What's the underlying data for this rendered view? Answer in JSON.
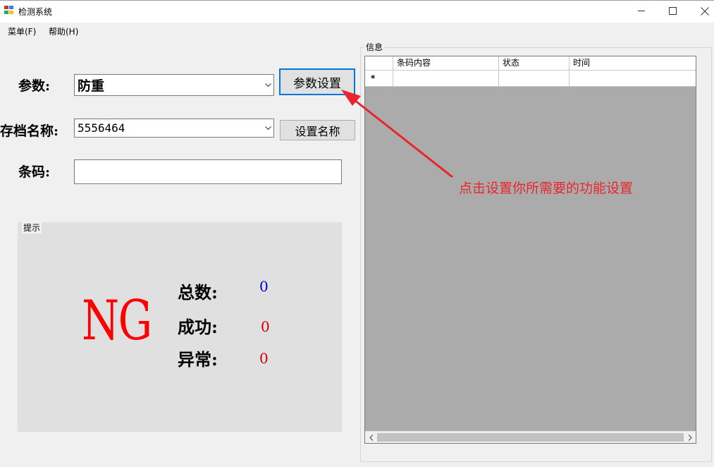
{
  "window": {
    "title": "检测系统",
    "minimize_icon": "minimize-icon",
    "maximize_icon": "maximize-icon",
    "close_icon": "close-icon"
  },
  "menu": {
    "items": [
      {
        "label": "菜单(F)"
      },
      {
        "label": "帮助(H)"
      }
    ]
  },
  "form": {
    "param_label": "参数:",
    "param_value": "防重",
    "param_button": "参数设置",
    "archive_label": "存档名称:",
    "archive_value": "5556464",
    "archive_button": "设置名称",
    "barcode_label": "条码:",
    "barcode_value": ""
  },
  "hint": {
    "legend": "提示",
    "result": "NG",
    "result_color": "#ff0000",
    "total_label": "总数:",
    "total_value": "0",
    "total_color": "#0000cc",
    "success_label": "成功:",
    "success_value": "0",
    "success_color": "#d10000",
    "error_label": "异常:",
    "error_value": "0",
    "error_color": "#d10000"
  },
  "info": {
    "legend": "信息",
    "columns": [
      "条码内容",
      "状态",
      "时间"
    ],
    "new_row_marker": "*",
    "grid_background": "#ababab"
  },
  "annotation": {
    "text": "点击设置你所需要的功能设置",
    "color": "#e8262b"
  }
}
